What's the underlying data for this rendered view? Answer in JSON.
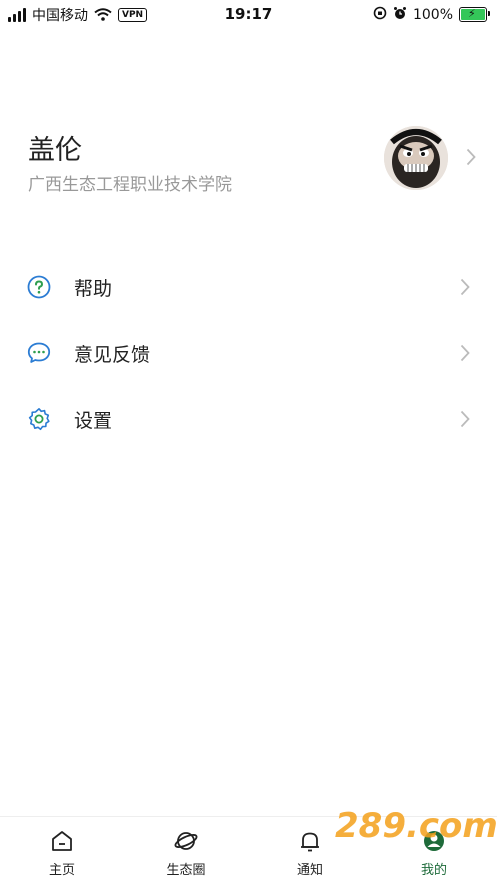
{
  "status_bar": {
    "carrier": "中国移动",
    "vpn": "VPN",
    "time": "19:17",
    "battery_pct": "100%",
    "battery_level": 1.0
  },
  "profile": {
    "name": "盖伦",
    "school": "广西生态工程职业技术学院"
  },
  "menu": {
    "items": [
      {
        "label": "帮助",
        "icon": "help-icon"
      },
      {
        "label": "意见反馈",
        "icon": "feedback-icon"
      },
      {
        "label": "设置",
        "icon": "settings-icon"
      }
    ]
  },
  "tabbar": {
    "tabs": [
      {
        "label": "主页",
        "icon": "home-icon",
        "active": false
      },
      {
        "label": "生态圈",
        "icon": "planet-icon",
        "active": false
      },
      {
        "label": "通知",
        "icon": "bell-icon",
        "active": false
      },
      {
        "label": "我的",
        "icon": "user-icon",
        "active": true
      }
    ]
  },
  "watermark": "289.com",
  "colors": {
    "accent": "#1e6b3a",
    "icon_blue": "#2b7cd3",
    "icon_green": "#2e9e4f",
    "muted_text": "#999999"
  }
}
